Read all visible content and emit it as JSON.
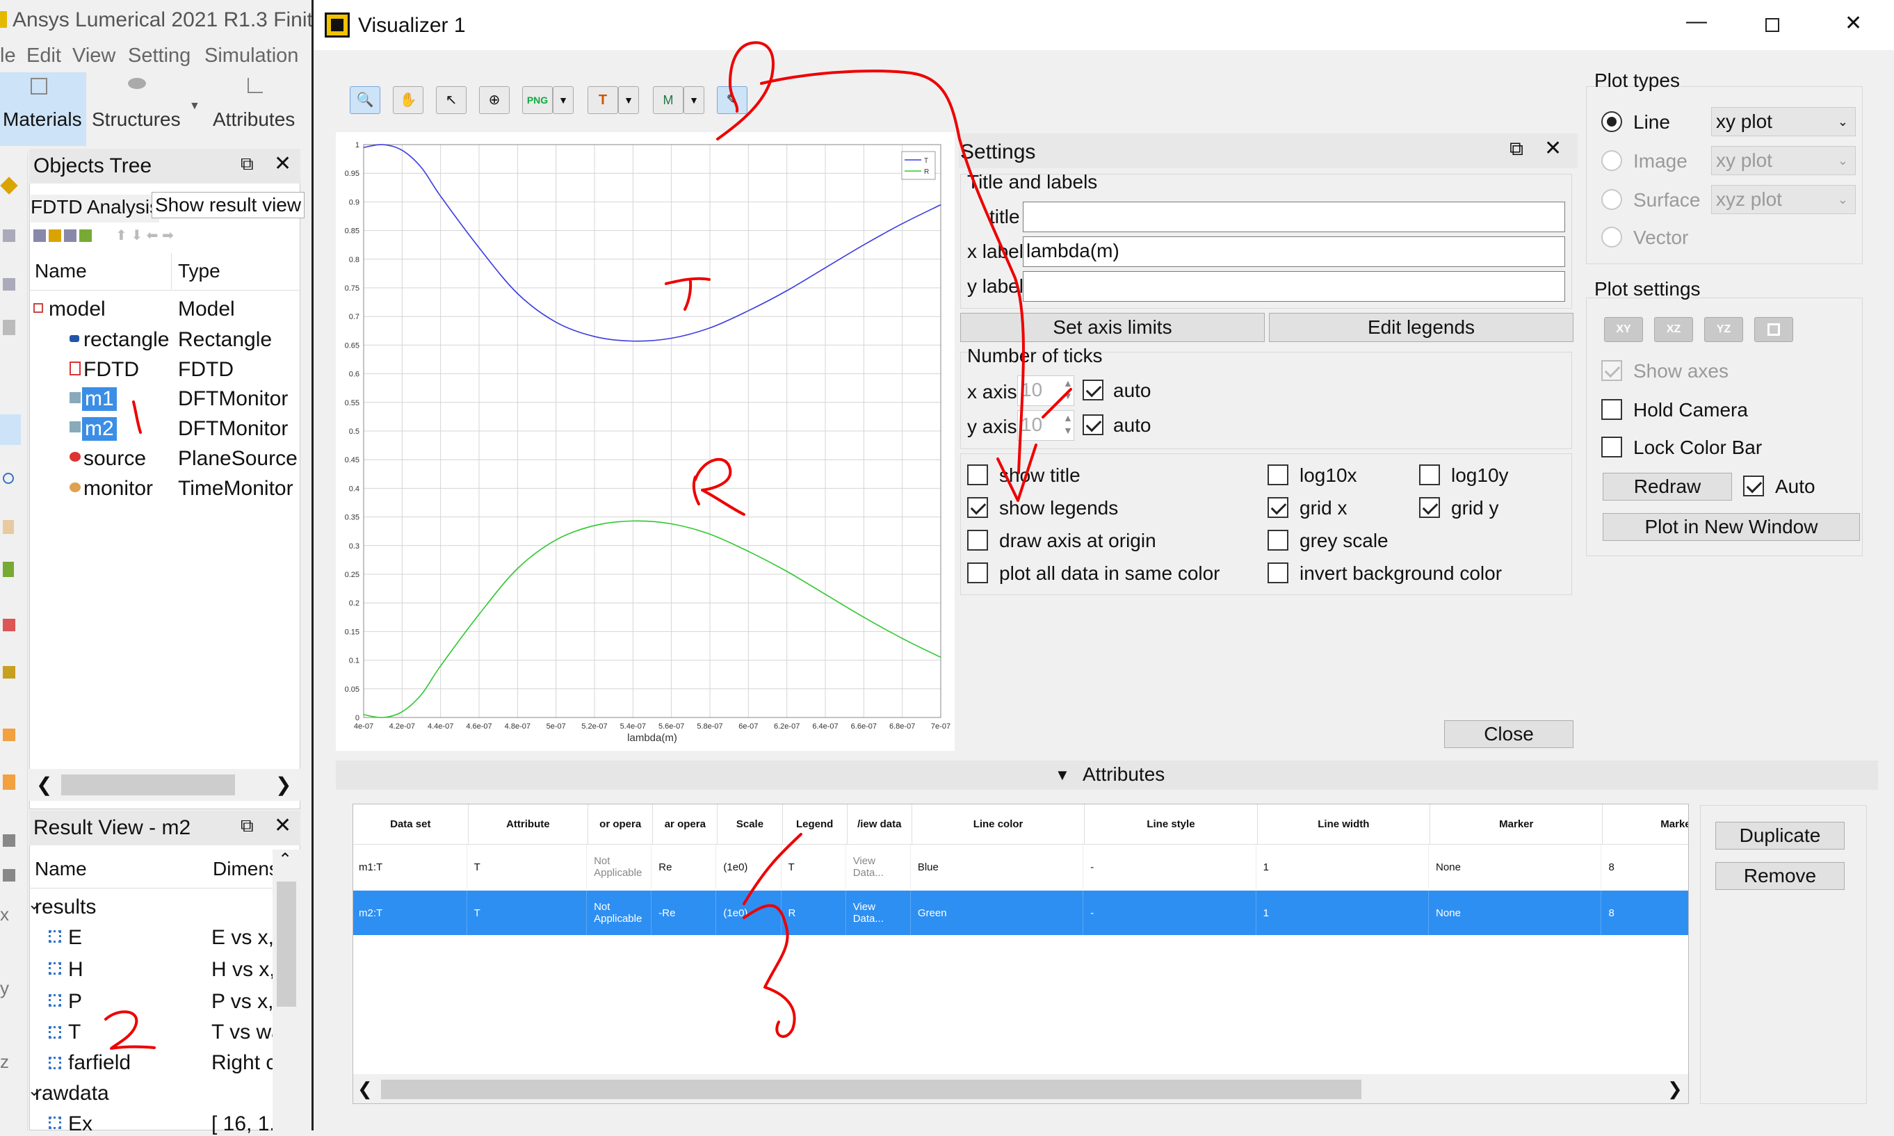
{
  "left": {
    "title": "Ansys Lumerical 2021 R1.3 Finite",
    "menu": [
      "le",
      "Edit",
      "View",
      "Setting",
      "Simulation"
    ],
    "ribbon": [
      "Materials",
      "Structures",
      "Attributes"
    ],
    "objects_tree": {
      "title": "Objects Tree",
      "tab1": "FDTD Analysis",
      "tab2": "Show result view",
      "col_name": "Name",
      "col_type": "Type",
      "rows": [
        {
          "name": "model",
          "type": "Model"
        },
        {
          "name": "rectangle",
          "type": "Rectangle"
        },
        {
          "name": "FDTD",
          "type": "FDTD"
        },
        {
          "name": "m1",
          "type": "DFTMonitor"
        },
        {
          "name": "m2",
          "type": "DFTMonitor"
        },
        {
          "name": "source",
          "type": "PlaneSource"
        },
        {
          "name": "monitor",
          "type": "TimeMonitor"
        }
      ]
    },
    "result_view": {
      "title": "Result View - m2",
      "col_name": "Name",
      "col_dim": "Dimens",
      "rows": [
        {
          "name": "results",
          "dim": ""
        },
        {
          "name": "E",
          "dim": "E vs x,"
        },
        {
          "name": "H",
          "dim": "H vs x,"
        },
        {
          "name": "P",
          "dim": "P vs x,"
        },
        {
          "name": "T",
          "dim": "T vs wa"
        },
        {
          "name": "farfield",
          "dim": "Right c"
        },
        {
          "name": "rawdata",
          "dim": ""
        },
        {
          "name": "Ex",
          "dim": "[ 16, 1."
        }
      ]
    },
    "side_letters": [
      "x",
      "y",
      "z"
    ]
  },
  "viz": {
    "title": "Visualizer 1",
    "toolbar_text": {
      "png": "PNG",
      "t": "T",
      "m": "M"
    },
    "settings": {
      "title": "Settings",
      "title_labels": "Title and labels",
      "title_label": "title",
      "title_value": "",
      "xlabel_label": "x label",
      "xlabel_value": "lambda(m)",
      "ylabel_label": "y label",
      "ylabel_value": "",
      "set_axis_limits": "Set axis limits",
      "edit_legends": "Edit legends",
      "num_ticks": "Number of ticks",
      "xaxis": "x axis",
      "xaxis_val": "10",
      "yaxis": "y axis",
      "yaxis_val": "10",
      "auto": "auto",
      "show_title": "show title",
      "show_legends": "show legends",
      "draw_axis": "draw axis at origin",
      "plot_same_color": "plot all data in same color",
      "log10x": "log10x",
      "log10y": "log10y",
      "gridx": "grid x",
      "gridy": "grid y",
      "grey": "grey scale",
      "invert": "invert background color",
      "close": "Close"
    },
    "plot_types": {
      "title": "Plot types",
      "line": "Line",
      "image": "Image",
      "surface": "Surface",
      "vector": "Vector",
      "line_combo": "xy plot",
      "image_combo": "xy plot",
      "surface_combo": "xyz plot"
    },
    "plot_settings": {
      "title": "Plot settings",
      "xy": "XY",
      "xz": "XZ",
      "yz": "YZ",
      "show_axes": "Show axes",
      "hold_camera": "Hold Camera",
      "lock_color_bar": "Lock Color Bar",
      "redraw": "Redraw",
      "auto": "Auto",
      "plot_new_window": "Plot in New Window"
    },
    "attributes": {
      "header": "Attributes",
      "columns": [
        "Data set",
        "Attribute",
        "or opera",
        "ar opera",
        "Scale",
        "Legend",
        "/iew data",
        "Line color",
        "Line style",
        "Line width",
        "Marker",
        "Marker size"
      ],
      "rows": [
        {
          "cells": [
            "m1:T",
            "T",
            "Not\nApplicable",
            "Re",
            "(1e0)",
            "T",
            "View\nData...",
            "Blue",
            "-",
            "1",
            "None",
            "8"
          ]
        },
        {
          "cells": [
            "m2:T",
            "T",
            "Not\nApplicable",
            "-Re",
            "(1e0)",
            "R",
            "View\nData...",
            "Green",
            "-",
            "1",
            "None",
            "8"
          ]
        }
      ],
      "duplicate": "Duplicate",
      "remove": "Remove"
    },
    "annotations": {
      "T": "T",
      "R": "R",
      "one": "1",
      "two": "2",
      "three": "3"
    }
  },
  "chart_data": {
    "type": "line",
    "xlabel": "lambda(m)",
    "xlim": [
      4e-07,
      7e-07
    ],
    "ylim": [
      0,
      1
    ],
    "x_ticks": [
      "4e-07",
      "4.2e-07",
      "4.4e-07",
      "4.6e-07",
      "4.8e-07",
      "5e-07",
      "5.2e-07",
      "5.4e-07",
      "5.6e-07",
      "5.8e-07",
      "6e-07",
      "6.2e-07",
      "6.4e-07",
      "6.6e-07",
      "6.8e-07",
      "7e-07"
    ],
    "y_ticks": [
      "0",
      "0.05",
      "0.1",
      "0.15",
      "0.2",
      "0.25",
      "0.3",
      "0.35",
      "0.4",
      "0.45",
      "0.5",
      "0.55",
      "0.6",
      "0.65",
      "0.7",
      "0.75",
      "0.8",
      "0.85",
      "0.9",
      "0.95",
      "1"
    ],
    "grid": true,
    "legend_placement": "top-right",
    "series": [
      {
        "name": "T",
        "color": "#3a3ae0",
        "x": [
          4e-07,
          4.1e-07,
          4.2e-07,
          4.3e-07,
          4.4e-07,
          4.6e-07,
          4.8e-07,
          5e-07,
          5.2e-07,
          5.4e-07,
          5.6e-07,
          5.8e-07,
          6e-07,
          6.2e-07,
          6.4e-07,
          6.6e-07,
          6.8e-07,
          7e-07
        ],
        "y": [
          0.995,
          1.0,
          0.99,
          0.96,
          0.91,
          0.82,
          0.74,
          0.69,
          0.665,
          0.657,
          0.662,
          0.68,
          0.71,
          0.745,
          0.785,
          0.825,
          0.862,
          0.895
        ]
      },
      {
        "name": "R",
        "color": "#2ec82e",
        "x": [
          4e-07,
          4.1e-07,
          4.2e-07,
          4.3e-07,
          4.4e-07,
          4.6e-07,
          4.8e-07,
          5e-07,
          5.2e-07,
          5.4e-07,
          5.6e-07,
          5.8e-07,
          6e-07,
          6.2e-07,
          6.4e-07,
          6.6e-07,
          6.8e-07,
          7e-07
        ],
        "y": [
          0.005,
          0.0,
          0.01,
          0.04,
          0.09,
          0.18,
          0.26,
          0.31,
          0.335,
          0.343,
          0.338,
          0.32,
          0.29,
          0.255,
          0.215,
          0.175,
          0.138,
          0.105
        ]
      }
    ]
  }
}
